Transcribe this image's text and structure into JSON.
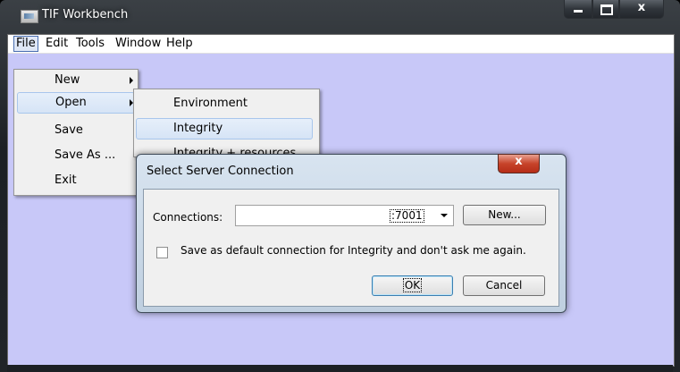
{
  "window": {
    "title": "TIF Workbench",
    "caption": {
      "minimize": "",
      "maximize": "",
      "close": "x"
    }
  },
  "menubar": {
    "items": [
      "File",
      "Edit",
      "Tools",
      "Window",
      "Help"
    ]
  },
  "file_menu": {
    "items": [
      {
        "label": "New",
        "submenu": true
      },
      {
        "label": "Open",
        "submenu": true,
        "highlighted": true
      },
      {
        "label": "Save"
      },
      {
        "label": "Save As ..."
      },
      {
        "label": "Exit"
      }
    ]
  },
  "open_submenu": {
    "items": [
      {
        "label": "Environment"
      },
      {
        "label": "Integrity",
        "highlighted": true
      },
      {
        "label": "Integrity + resources"
      }
    ]
  },
  "dialog": {
    "title": "Select Server Connection",
    "close": "x",
    "connections_label": "Connections:",
    "connection_value": ":7001",
    "new_button": "New...",
    "checkbox_label": "Save as default connection for Integrity and don't ask me again.",
    "checkbox_checked": false,
    "ok_button": "OK",
    "cancel_button": "Cancel"
  },
  "colors": {
    "client_background": "#c8c8f8",
    "menu_highlight": "#d6e4f6",
    "close_button": "#c7432a"
  }
}
